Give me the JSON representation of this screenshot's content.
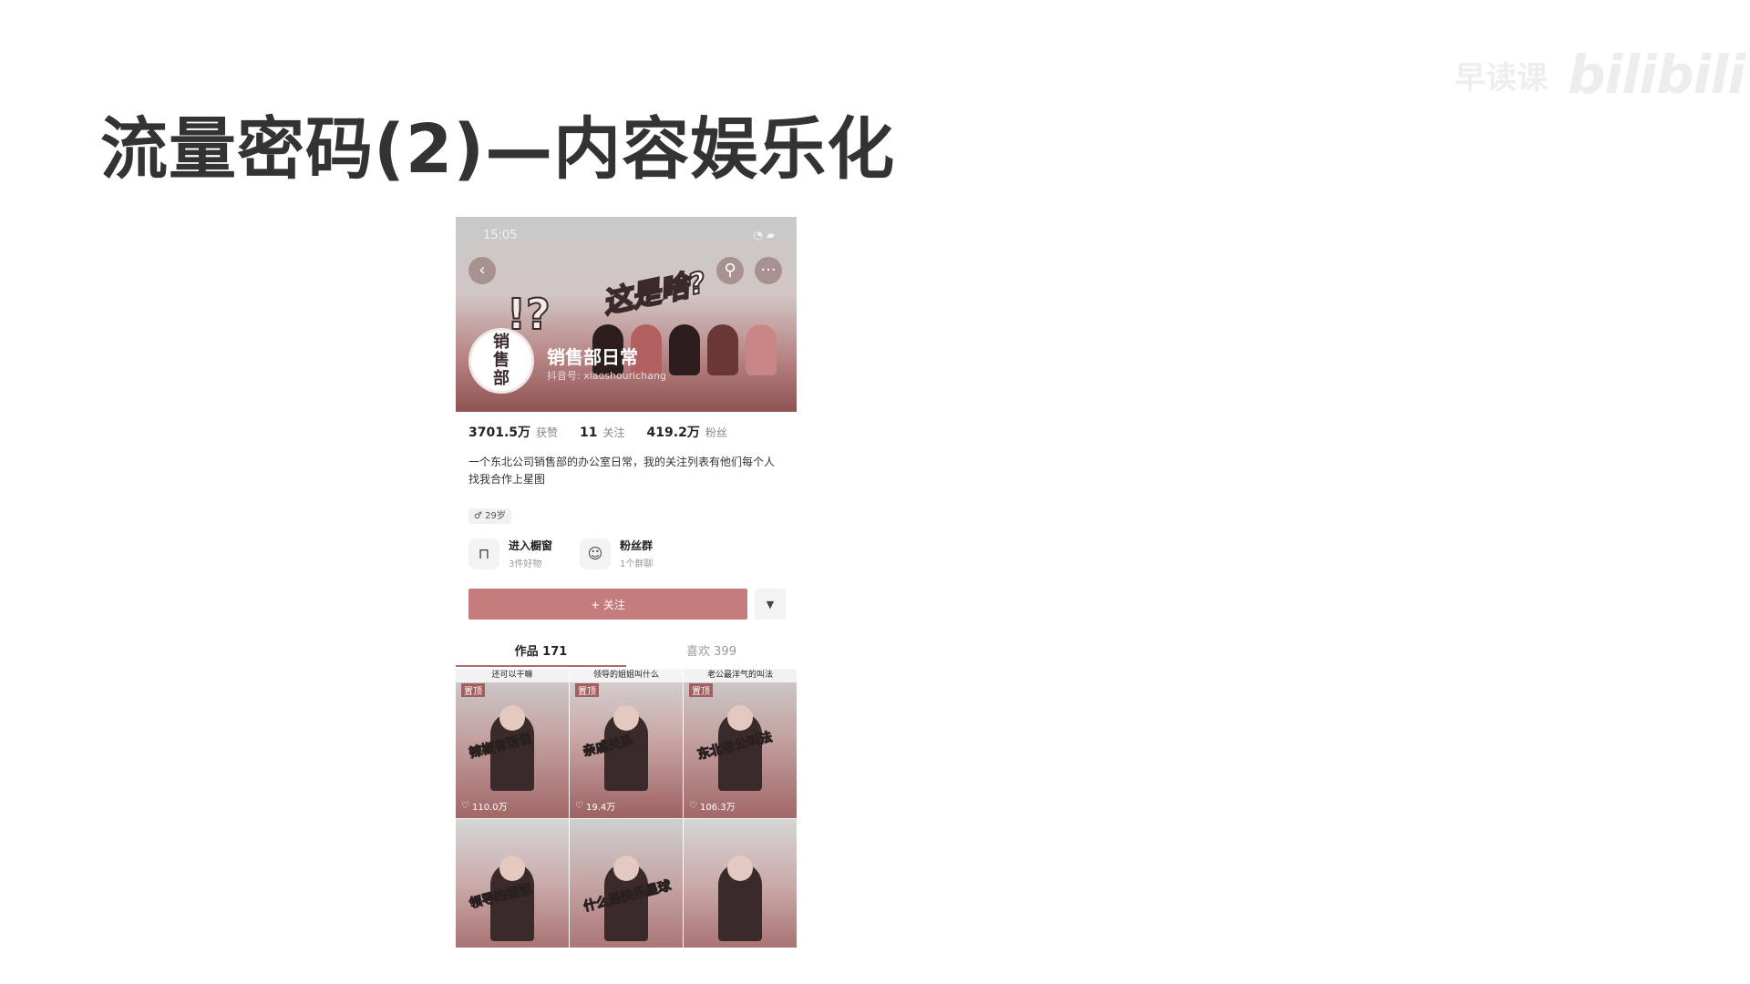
{
  "slide": {
    "title": "流量密码(2)—内容娱乐化",
    "watermark_text": "早读课",
    "watermark_logo": "bilibili"
  },
  "phone": {
    "status_time": "15:05",
    "status_icons": "◔ ▰",
    "banner_text": "这是啥?",
    "banner_marks": "!?",
    "avatar_text": "销\n售\n部",
    "account_name": "销售部日常",
    "account_id": "抖音号: xiaoshourichang",
    "stats": [
      {
        "value": "3701.5万",
        "label": "获赞"
      },
      {
        "value": "11",
        "label": "关注"
      },
      {
        "value": "419.2万",
        "label": "粉丝"
      }
    ],
    "bio_line1": "一个东北公司销售部的办公室日常，我的关注列表有他们每个人",
    "bio_line2": "找我合作上星图",
    "age_tag": "♂ 29岁",
    "features": [
      {
        "icon": "shopping-bag-icon",
        "title": "进入橱窗",
        "subtitle": "3件好物"
      },
      {
        "icon": "fan-group-icon",
        "title": "粉丝群",
        "subtitle": "1个群聊"
      }
    ],
    "follow_label": "+ 关注",
    "dropdown_label": "▼",
    "tabs": [
      {
        "label": "作品 171",
        "active": true
      },
      {
        "label": "喜欢 399",
        "active": false
      }
    ],
    "videos": [
      {
        "caption": "还可以干嘛",
        "pinned": "置顶",
        "sticker": "辣椒有话说",
        "likes": "110.0万"
      },
      {
        "caption": "领导的姐姐叫什么",
        "pinned": "置顶",
        "sticker": "亲戚关系",
        "likes": "19.4万"
      },
      {
        "caption": "老公最洋气的叫法",
        "pinned": "置顶",
        "sticker": "东北老公叫法",
        "likes": "106.3万"
      },
      {
        "caption": "",
        "pinned": "",
        "sticker": "领导的姐姐",
        "likes": ""
      },
      {
        "caption": "",
        "pinned": "",
        "sticker": "什么是快乐星球",
        "likes": ""
      },
      {
        "caption": "",
        "pinned": "",
        "sticker": "",
        "likes": ""
      }
    ]
  },
  "colors": {
    "accent": "#c37b7b",
    "banner_dark": "#8e5353"
  }
}
